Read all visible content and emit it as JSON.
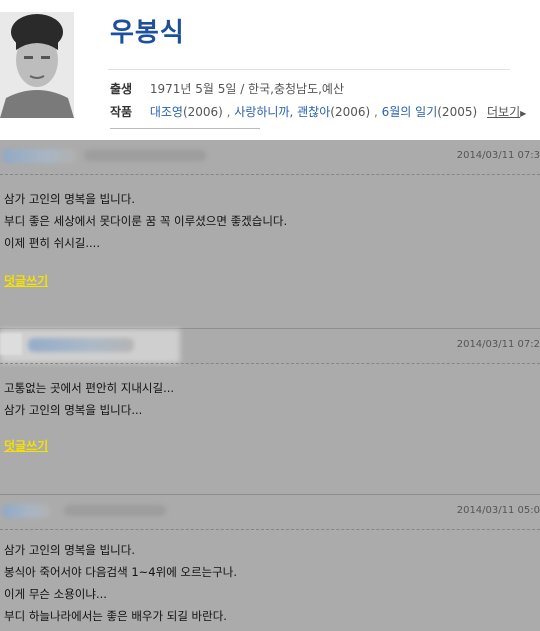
{
  "profile": {
    "name": "우봉식",
    "birth_label": "출생",
    "birth_value": "1971년 5월 5일 / 한국,충청남도,예산",
    "works_label": "작품",
    "works": [
      {
        "title": "대조영",
        "year": "(2006)"
      },
      {
        "title": "사랑하니까, 괜찮아",
        "year": "(2006)"
      },
      {
        "title": "6월의 일기",
        "year": "(2005)"
      }
    ],
    "works_sep": " , ",
    "more_label": "더보기"
  },
  "comments": [
    {
      "date": "2014/03/11 07:3",
      "lines": [
        "삼가 고인의 명복을 빕니다.",
        "부디 좋은 세상에서 못다이룬 꿈 꼭 이루셨으면 좋겠습니다.",
        "이제 편히 쉬시길...."
      ],
      "reply_label": "덧글쓰기"
    },
    {
      "date": "2014/03/11 07:2",
      "lines": [
        "고통없는 곳에서 편안히 지내시길...",
        "삼가 고인의 명복을 빕니다..."
      ],
      "reply_label": "덧글쓰기"
    },
    {
      "date": "2014/03/11 05:0",
      "lines": [
        "삼가 고인의 명복을 빕니다.",
        "봉식아 죽어서야 다음검색 1~4위에 오르는구나.",
        "이게 무슨 소용이냐...",
        "부디 하늘나라에서는 좋은 배우가 되길 바란다."
      ]
    }
  ]
}
